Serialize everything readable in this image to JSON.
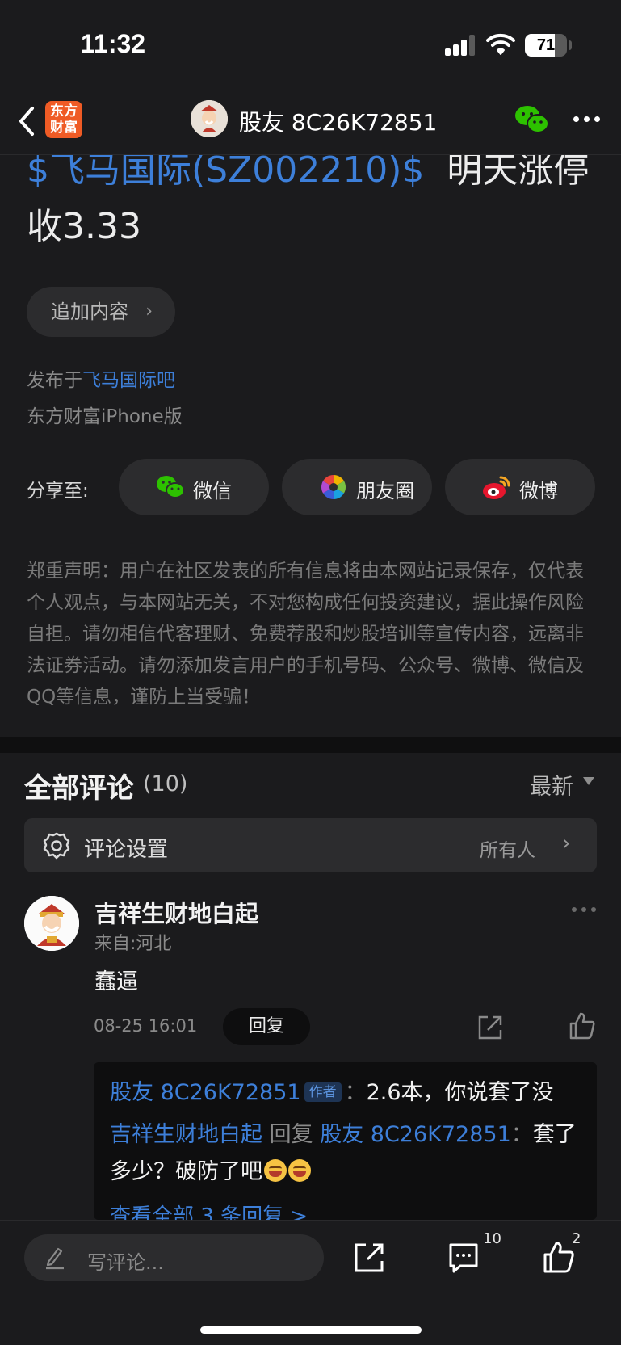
{
  "status_bar": {
    "time": "11:32",
    "battery": "71",
    "battery_level": 0.71
  },
  "nav": {
    "logo_line1": "东方",
    "logo_line2": "财富",
    "title": "股友 8C26K72851"
  },
  "post": {
    "stock_tag": "$飞马国际(SZ002210)$",
    "text_part1": "明天涨停",
    "text_part2": "收3.33",
    "add_content": "追加内容",
    "published_prefix": "发布于",
    "forum": "飞马国际吧",
    "client": "东方财富iPhone版"
  },
  "share": {
    "label": "分享至:",
    "buttons": [
      {
        "label": "微信",
        "icon": "wechat-icon"
      },
      {
        "label": "朋友圈",
        "icon": "moments-icon"
      },
      {
        "label": "微博",
        "icon": "weibo-icon"
      }
    ]
  },
  "disclaimer": "郑重声明：用户在社区发表的所有信息将由本网站记录保存，仅代表个人观点，与本网站无关，不对您构成任何投资建议，据此操作风险自担。请勿相信代客理财、免费荐股和炒股培训等宣传内容，远离非法证券活动。请勿添加发言用户的手机号码、公众号、微博、微信及QQ等信息，谨防上当受骗！",
  "comments_header": {
    "title": "全部评论",
    "count": "(10)",
    "sort": "最新"
  },
  "comment_settings": {
    "label": "评论设置",
    "value": "所有人"
  },
  "comment": {
    "user": "吉祥生财地白起",
    "location": "来自:河北",
    "text": "蠢逼",
    "time": "08-25 16:01",
    "reply_label": "回复",
    "replies": [
      {
        "user": "股友 8C26K72851",
        "tag": "作者",
        "text": "2.6本，你说套了没"
      },
      {
        "user": "吉祥生财地白起",
        "reply_word": "回复",
        "target": "股友 8C26K72851",
        "text": "套了多少？破防了吧"
      }
    ],
    "view_all": "查看全部 3 条回复 >"
  },
  "bottom_bar": {
    "placeholder": "写评论...",
    "comment_count": "10",
    "like_count": "2"
  },
  "colors": {
    "background": "#1b1b1d",
    "link_blue": "#3d7fd9",
    "card": "#2c2c2e",
    "logo_orange": "#ef5b25"
  }
}
